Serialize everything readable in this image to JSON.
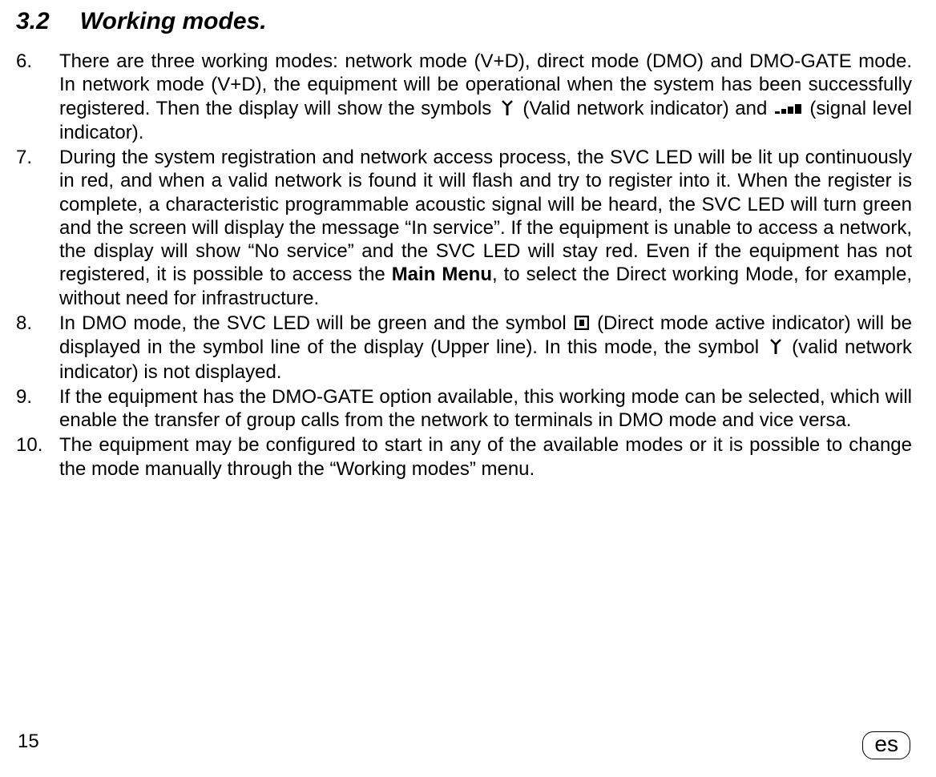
{
  "heading": {
    "number": "3.2",
    "title": "Working modes."
  },
  "items": [
    {
      "marker": "6.",
      "pre1": "There are three working modes: network mode (V+D), direct mode (DMO) and DMO-GATE mode. In network mode (V+D), the equipment will be operational when the system has been successfully registered. Then the display will show the symbols ",
      "post1": " (Valid network indicator) and ",
      "post2": " (signal level indicator)."
    },
    {
      "marker": "7.",
      "text_a": "During the system registration and network access process, the SVC LED will be lit up continuously in red, and when a valid network is found it will flash and try to register into it. When the register is complete, a characteristic programmable acoustic signal will be heard, the SVC LED will turn green and the screen will display the message “In service”. If the equipment is unable to access a network, the display will show “No service” and the SVC LED will stay red. Even if the equipment has not registered, it is possible to access the ",
      "bold": "Main Menu",
      "text_b": ", to select the Direct working Mode, for example, without need for infrastructure."
    },
    {
      "marker": "8.",
      "pre1": "In DMO mode, the SVC LED will be green and the symbol ",
      "mid1": " (Direct mode active indicator) will be displayed in the symbol line of the display (Upper line). In this mode, the symbol ",
      "post1": " (valid network indicator) is not displayed."
    },
    {
      "marker": "9.",
      "text": "If the equipment has the DMO-GATE option available, this working mode can be selected, which will enable the transfer of group calls from the network to terminals in DMO mode and vice versa."
    },
    {
      "marker": "10.",
      "text": "The equipment may be configured to start in any of the available modes or it is possible to change the mode manually through the “Working modes” menu."
    }
  ],
  "pageNumber": "15",
  "langBadge": "es"
}
